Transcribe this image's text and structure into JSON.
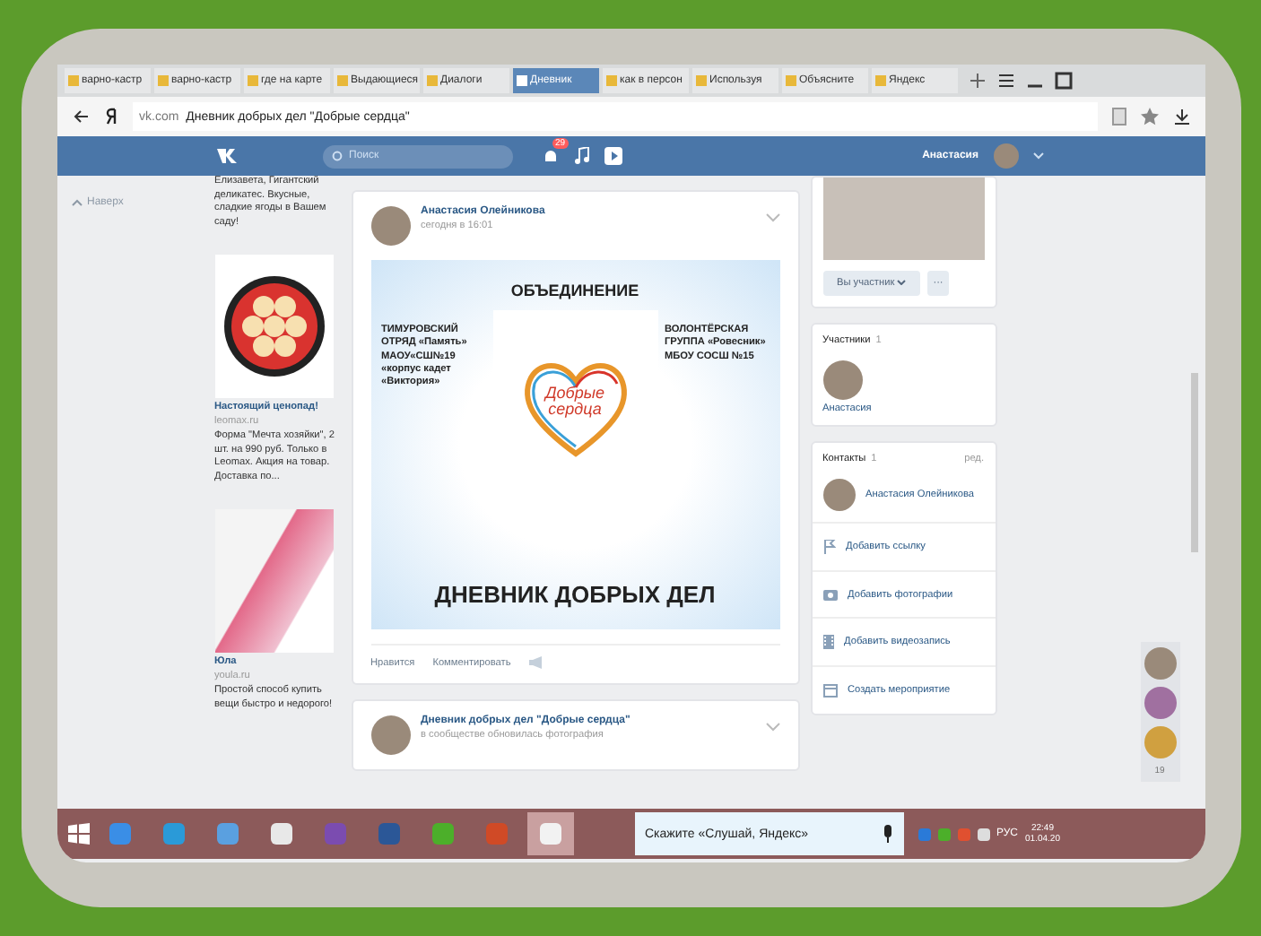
{
  "browser": {
    "tabs": [
      {
        "label": "варно-кастр",
        "selected": false
      },
      {
        "label": "варно-кастр",
        "selected": false
      },
      {
        "label": "где на карте",
        "selected": false
      },
      {
        "label": "Выдающиеся",
        "selected": false
      },
      {
        "label": "Диалоги",
        "selected": false
      },
      {
        "label": "Дневник",
        "selected": true
      },
      {
        "label": "как в персон",
        "selected": false
      },
      {
        "label": "Используя",
        "selected": false
      },
      {
        "label": "Объясните",
        "selected": false
      },
      {
        "label": "Яндекс",
        "selected": false
      }
    ],
    "address": {
      "domain": "vk.com",
      "title": "Дневник добрых дел \"Добрые сердца\""
    }
  },
  "vk_header": {
    "search_placeholder": "Поиск",
    "notification_count": "29",
    "user_name": "Анастасия"
  },
  "left_nav": {
    "back_to_top": "Наверх"
  },
  "ads": [
    {
      "kind": "text",
      "text": "Елизавета, Гигантский деликатес. Вкусные, сладкие ягоды в Вашем саду!"
    },
    {
      "kind": "pan",
      "title": "Настоящий ценопад!",
      "domain": "leomax.ru",
      "text": "Форма \"Мечта хозяйки\", 2 шт. на 990 руб. Только в Leomax. Акция на товар. Доставка по..."
    },
    {
      "kind": "goods",
      "title": "Юла",
      "domain": "youla.ru",
      "text": "Простой способ купить вещи быстро и недорого!"
    }
  ],
  "posts": [
    {
      "author": "Анастасия Олейникова",
      "time": "сегодня в 16:01",
      "poster": {
        "heading": "ОБЪЕДИНЕНИЕ",
        "left": "ТИМУРОВСКИЙ ОТРЯД «Память» МАОУ«СШ№19 «корпус кадет «Виктория»",
        "right": "ВОЛОНТЁРСКАЯ ГРУППА «Ровесник» МБОУ СОСШ №15",
        "logo": "Добрые сердца",
        "footer": "ДНЕВНИК ДОБРЫХ ДЕЛ"
      },
      "actions": [
        "Нравится",
        "Комментировать"
      ]
    },
    {
      "author": "Дневник добрых дел \"Добрые сердца\"",
      "time": "в сообществе обновилась фотография"
    }
  ],
  "right_column": {
    "member_button": "Вы участник",
    "more_button": "···",
    "members": {
      "title": "Участники",
      "count": "1",
      "names": [
        "Анастасия"
      ]
    },
    "contacts": {
      "title": "Контакты",
      "count": "1",
      "edit": "ред.",
      "names": [
        "Анастасия Олейникова"
      ]
    },
    "actions": [
      {
        "kind": "link",
        "label": "Добавить ссылку"
      },
      {
        "kind": "photo",
        "label": "Добавить фотографии"
      },
      {
        "kind": "video",
        "label": "Добавить видеозапись"
      },
      {
        "kind": "event",
        "label": "Создать мероприятие"
      }
    ]
  },
  "friends_online": {
    "count": "19"
  },
  "taskbar": {
    "apps": [
      {
        "kind": "mail",
        "active": false
      },
      {
        "kind": "ie",
        "active": false
      },
      {
        "kind": "sound",
        "active": false
      },
      {
        "kind": "yandex",
        "active": false
      },
      {
        "kind": "vs",
        "active": false
      },
      {
        "kind": "word",
        "active": false
      },
      {
        "kind": "torrent",
        "active": false
      },
      {
        "kind": "powerpoint",
        "active": false
      },
      {
        "kind": "ybrowser",
        "active": true
      }
    ],
    "search_placeholder": "Скажите «Слушай, Яндекс»",
    "language": "РУС",
    "time": "22:49",
    "date": "01.04.20"
  }
}
